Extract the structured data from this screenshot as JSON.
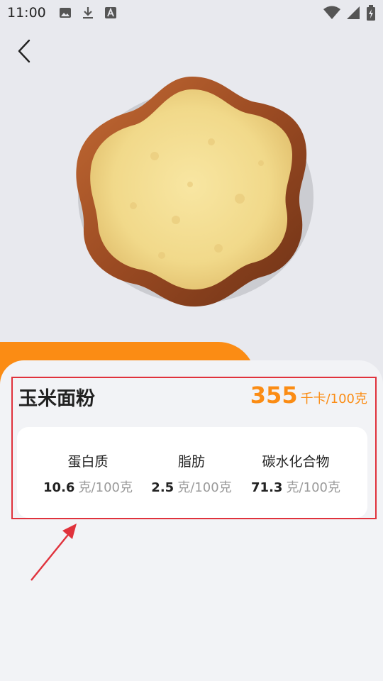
{
  "status_bar": {
    "time": "11:00",
    "left_icons": [
      "image-icon",
      "download-icon",
      "text-a-icon"
    ],
    "right_icons": [
      "wifi-icon",
      "signal-icon",
      "battery-charging-icon"
    ]
  },
  "header": {
    "back_icon": "chevron-left-icon"
  },
  "food": {
    "name": "玉米面粉",
    "calories_value": "355",
    "calories_unit": "千卡/100克",
    "image_desc": "wooden-bowl-cornmeal"
  },
  "nutrients": [
    {
      "name": "蛋白质",
      "value": "10.6",
      "unit": "克/100克"
    },
    {
      "name": "脂肪",
      "value": "2.5",
      "unit": "克/100克"
    },
    {
      "name": "碳水化合物",
      "value": "71.3",
      "unit": "克/100克"
    }
  ],
  "colors": {
    "accent": "#fb8c14",
    "highlight": "#e0323c",
    "background": "#e8e9ee",
    "sheet": "#f2f3f6"
  }
}
